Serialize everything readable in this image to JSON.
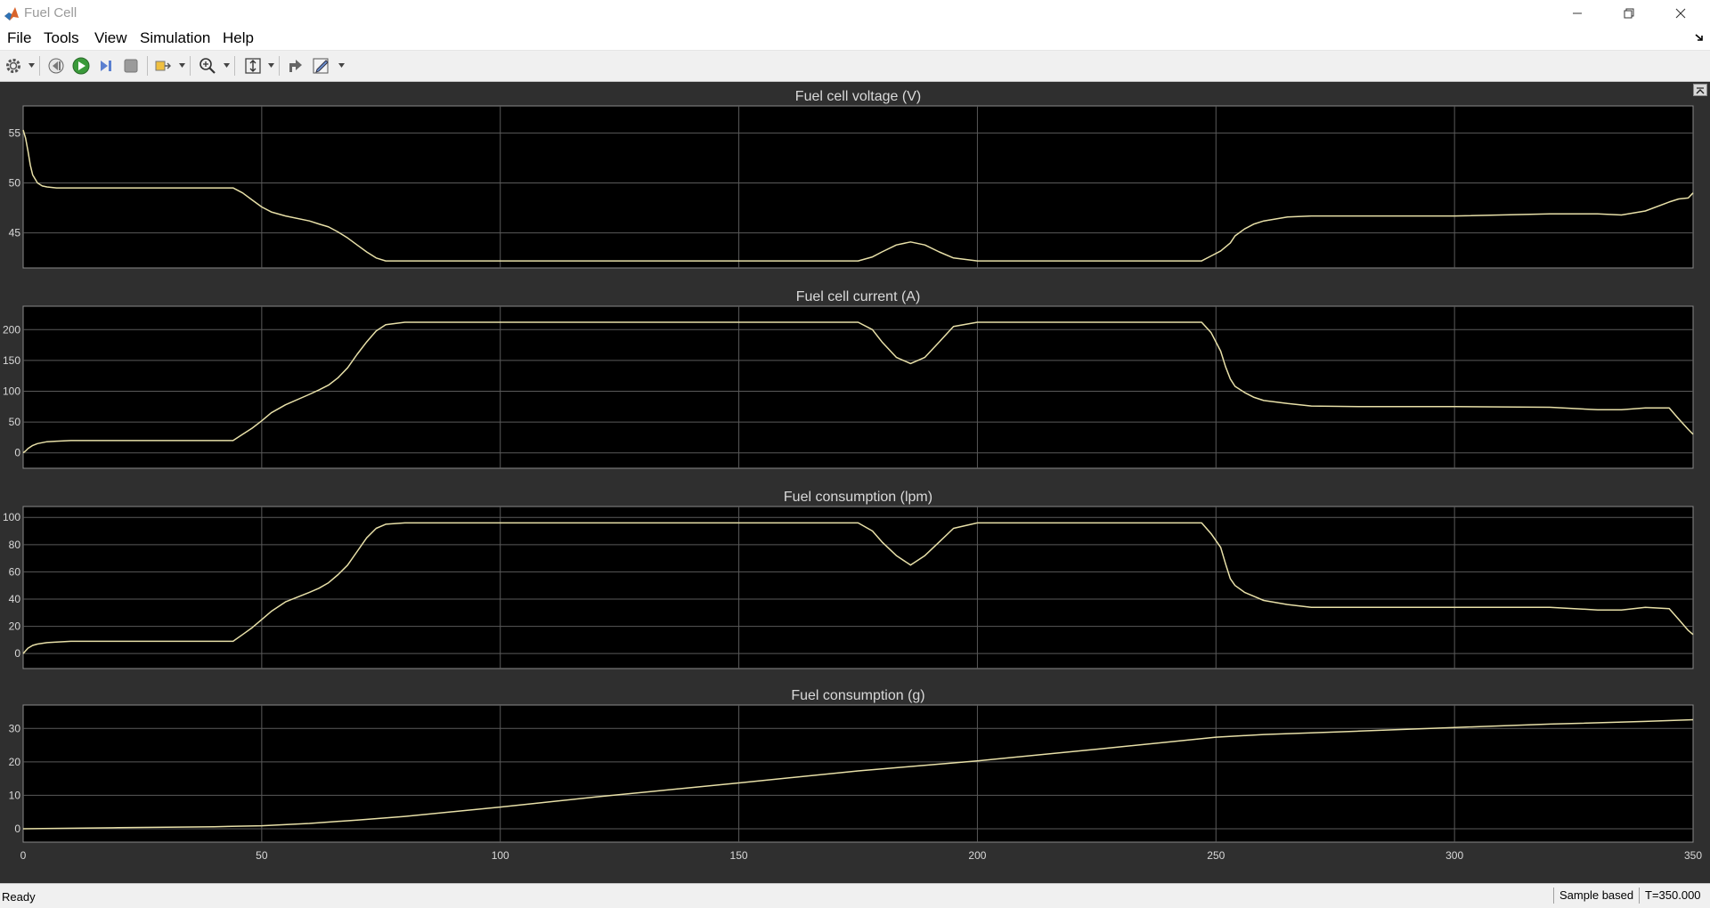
{
  "window": {
    "title": "Fuel Cell",
    "icons": {
      "app": "matlab-icon",
      "minimize": "minimize-icon",
      "restore": "restore-icon",
      "close": "close-icon"
    }
  },
  "menu": {
    "items": [
      "File",
      "Tools",
      "View",
      "Simulation",
      "Help"
    ]
  },
  "toolbar": {
    "icons": [
      "settings-icon",
      "step-back-icon",
      "run-icon",
      "step-forward-icon",
      "stop-icon",
      "highlight-icon",
      "zoom-icon",
      "scale-icon",
      "signal-icon",
      "edit-icon"
    ]
  },
  "status": {
    "left": "Ready",
    "mode": "Sample based",
    "time": "T=350.000"
  },
  "colors": {
    "trace": "#e8e0a8",
    "plot_bg": "#000000",
    "grid": "#5a5a5a",
    "text": "#d9d9d9"
  },
  "chart_data": [
    {
      "type": "line",
      "title": "Fuel cell voltage (V)",
      "xlim": [
        0,
        350
      ],
      "ylim": [
        41.5,
        57.7
      ],
      "xticks": [
        0,
        50,
        100,
        150,
        200,
        250,
        300,
        350
      ],
      "yticks": [
        45,
        50,
        55
      ],
      "x": [
        0,
        0.5,
        1,
        1.5,
        2,
        3,
        4,
        5,
        7,
        10,
        20,
        30,
        40,
        44,
        46,
        48,
        50,
        52,
        55,
        60,
        62,
        64,
        66,
        68,
        70,
        72,
        74,
        76,
        80,
        100,
        150,
        175,
        178,
        180,
        183,
        186,
        189,
        192,
        195,
        200,
        240,
        247,
        249,
        251,
        252,
        253,
        254,
        256,
        258,
        260,
        265,
        270,
        280,
        300,
        320,
        330,
        335,
        340,
        345,
        347,
        349,
        350
      ],
      "series": [
        {
          "values": [
            55.3,
            54.5,
            53.2,
            51.8,
            50.8,
            50.0,
            49.7,
            49.6,
            49.5,
            49.5,
            49.5,
            49.5,
            49.5,
            49.5,
            49.0,
            48.3,
            47.6,
            47.1,
            46.7,
            46.2,
            45.9,
            45.6,
            45.1,
            44.5,
            43.8,
            43.1,
            42.5,
            42.2,
            42.2,
            42.2,
            42.2,
            42.2,
            42.6,
            43.1,
            43.8,
            44.1,
            43.8,
            43.1,
            42.5,
            42.2,
            42.2,
            42.2,
            42.7,
            43.2,
            43.6,
            44.0,
            44.7,
            45.4,
            45.9,
            46.2,
            46.6,
            46.7,
            46.7,
            46.7,
            46.9,
            46.9,
            46.8,
            47.2,
            48.1,
            48.4,
            48.5,
            49.0
          ]
        }
      ]
    },
    {
      "type": "line",
      "title": "Fuel cell current (A)",
      "xlim": [
        0,
        350
      ],
      "ylim": [
        -25,
        238
      ],
      "xticks": [
        0,
        50,
        100,
        150,
        200,
        250,
        300,
        350
      ],
      "yticks": [
        0,
        50,
        100,
        150,
        200
      ],
      "x": [
        0,
        0.5,
        1,
        2,
        3,
        5,
        7,
        10,
        20,
        30,
        40,
        44,
        46,
        48,
        50,
        52,
        55,
        60,
        62,
        64,
        66,
        68,
        70,
        72,
        74,
        76,
        80,
        100,
        150,
        175,
        178,
        180,
        183,
        186,
        189,
        192,
        195,
        200,
        240,
        247,
        249,
        251,
        252,
        253,
        254,
        256,
        258,
        260,
        265,
        270,
        280,
        300,
        320,
        330,
        335,
        340,
        345,
        347,
        349,
        350
      ],
      "series": [
        {
          "values": [
            0,
            3,
            7,
            12,
            15,
            18,
            19,
            20,
            20,
            20,
            20,
            20,
            30,
            40,
            52,
            65,
            78,
            95,
            102,
            110,
            122,
            138,
            160,
            180,
            198,
            208,
            212,
            212,
            212,
            212,
            200,
            180,
            155,
            145,
            155,
            180,
            205,
            212,
            212,
            212,
            195,
            165,
            140,
            120,
            108,
            98,
            90,
            85,
            80,
            76,
            75,
            75,
            74,
            70,
            70,
            73,
            73,
            55,
            38,
            30
          ]
        }
      ]
    },
    {
      "type": "line",
      "title": "Fuel consumption (lpm)",
      "xlim": [
        0,
        350
      ],
      "ylim": [
        -11,
        108
      ],
      "xticks": [
        0,
        50,
        100,
        150,
        200,
        250,
        300,
        350
      ],
      "yticks": [
        0,
        20,
        40,
        60,
        80,
        100
      ],
      "x": [
        0,
        0.5,
        1,
        2,
        3,
        5,
        7,
        10,
        20,
        30,
        40,
        44,
        46,
        48,
        50,
        52,
        55,
        60,
        62,
        64,
        66,
        68,
        70,
        72,
        74,
        76,
        80,
        100,
        150,
        175,
        178,
        180,
        183,
        186,
        189,
        192,
        195,
        200,
        240,
        247,
        249,
        251,
        252,
        253,
        254,
        256,
        258,
        260,
        265,
        270,
        280,
        300,
        320,
        330,
        335,
        340,
        345,
        347,
        349,
        350
      ],
      "series": [
        {
          "values": [
            0,
            2,
            4,
            6,
            7,
            8,
            8.5,
            9,
            9,
            9,
            9,
            9,
            14,
            19,
            25,
            31,
            38,
            45,
            48,
            52,
            58,
            65,
            75,
            85,
            92,
            95,
            96,
            96,
            96,
            96,
            90,
            82,
            72,
            65,
            72,
            82,
            92,
            96,
            96,
            96,
            88,
            78,
            66,
            55,
            50,
            45,
            42,
            39,
            36,
            34,
            34,
            34,
            34,
            32,
            32,
            34,
            33,
            25,
            17,
            14
          ]
        }
      ]
    },
    {
      "type": "line",
      "title": "Fuel consumption (g)",
      "xlim": [
        0,
        350
      ],
      "ylim": [
        -4,
        37
      ],
      "xticks": [
        0,
        50,
        100,
        150,
        200,
        250,
        300,
        350
      ],
      "yticks": [
        0,
        10,
        20,
        30
      ],
      "x": [
        0,
        20,
        40,
        50,
        60,
        70,
        80,
        100,
        120,
        150,
        175,
        185,
        200,
        225,
        250,
        260,
        280,
        300,
        320,
        340,
        350
      ],
      "series": [
        {
          "values": [
            0,
            0.3,
            0.6,
            0.9,
            1.6,
            2.6,
            3.7,
            6.5,
            9.5,
            13.7,
            17.3,
            18.5,
            20.3,
            23.8,
            27.4,
            28.2,
            29.2,
            30.3,
            31.3,
            32.1,
            32.6
          ]
        }
      ]
    }
  ]
}
